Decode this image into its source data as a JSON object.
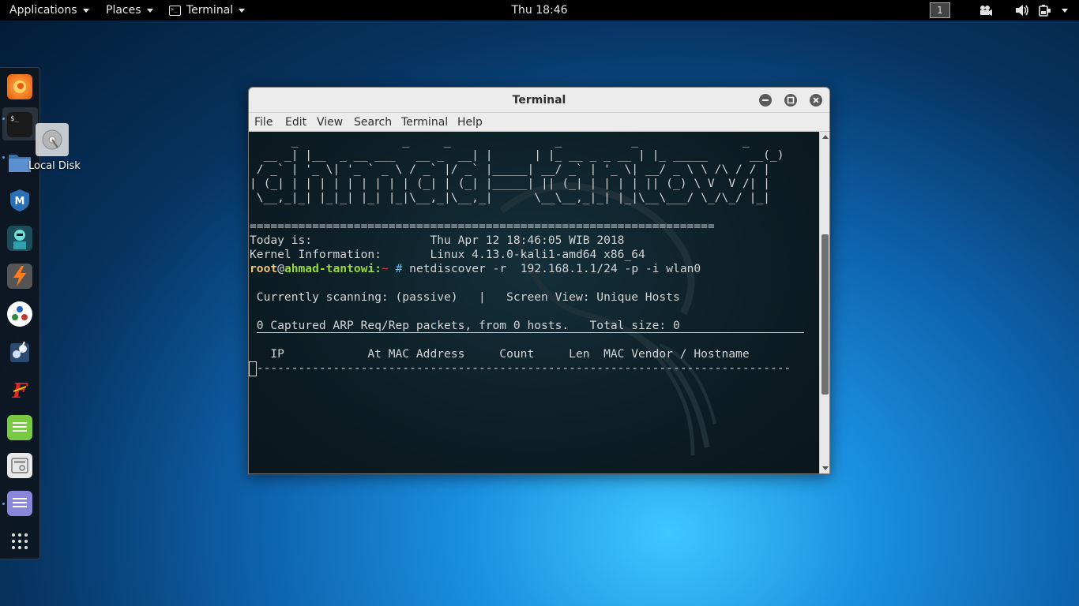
{
  "topbar": {
    "applications": "Applications",
    "places": "Places",
    "terminal": "Terminal",
    "clock": "Thu 18:46",
    "workspace": "1"
  },
  "dock": {
    "apps": [
      "firefox-icon",
      "terminal-icon",
      "files-icon",
      "metasploit-icon",
      "armitage-icon",
      "burpsuite-icon",
      "maltego-icon",
      "beef-icon",
      "faraday-icon",
      "leafpad-icon",
      "cutycapt-icon",
      "gedit-icon",
      "show-apps-icon"
    ]
  },
  "desktop": {
    "disk_label": "Local Disk"
  },
  "window": {
    "title": "Terminal",
    "menu": [
      "File",
      "Edit",
      "View",
      "Search",
      "Terminal",
      "Help"
    ]
  },
  "terminal": {
    "banner": [
      "      _               _     _               _          _               _",
      "  __ _| |__  _ __ ___   __ _  __| |      | |_ __ _ _ __ | |_ _____      __(_)",
      " / _` | '_ \\| '_ ` _ \\ / _` |/ _` |_____| __/ _` | '_ \\| __/ _ \\ \\ /\\ / / |",
      "| (_| | | | | | | | | | (_| | (_| |_____| || (_| | | | | || (_) \\ V  V /| |",
      " \\__,_|_| |_|_| |_| |_|\\__,_|\\__,_|      \\__\\__,_|_| |_|\\__\\___/ \\_/\\_/ |_|"
    ],
    "rule": "===================================================================",
    "today_label": "Today is:",
    "today_value": "Thu Apr 12 18:46:05 WIB 2018",
    "kernel_label": "Kernel Information:",
    "kernel_value": "Linux 4.13.0-kali1-amd64 x86_64",
    "prompt_user": "root",
    "prompt_at": "@",
    "prompt_host": "ahmad-tantowi",
    "prompt_sep": ":",
    "prompt_path": "~",
    "prompt_sym": "#",
    "command": "netdiscover -r  192.168.1.1/24 -p -i wlan0",
    "scan_line": " Currently scanning: (passive)   |   Screen View: Unique Hosts",
    "captured_line": " 0 Captured ARP Req/Rep packets, from 0 hosts.   Total size: 0",
    "header_line": "   IP            At MAC Address     Count     Len  MAC Vendor / Hostname",
    "dash_line": " -----------------------------------------------------------------------------"
  }
}
